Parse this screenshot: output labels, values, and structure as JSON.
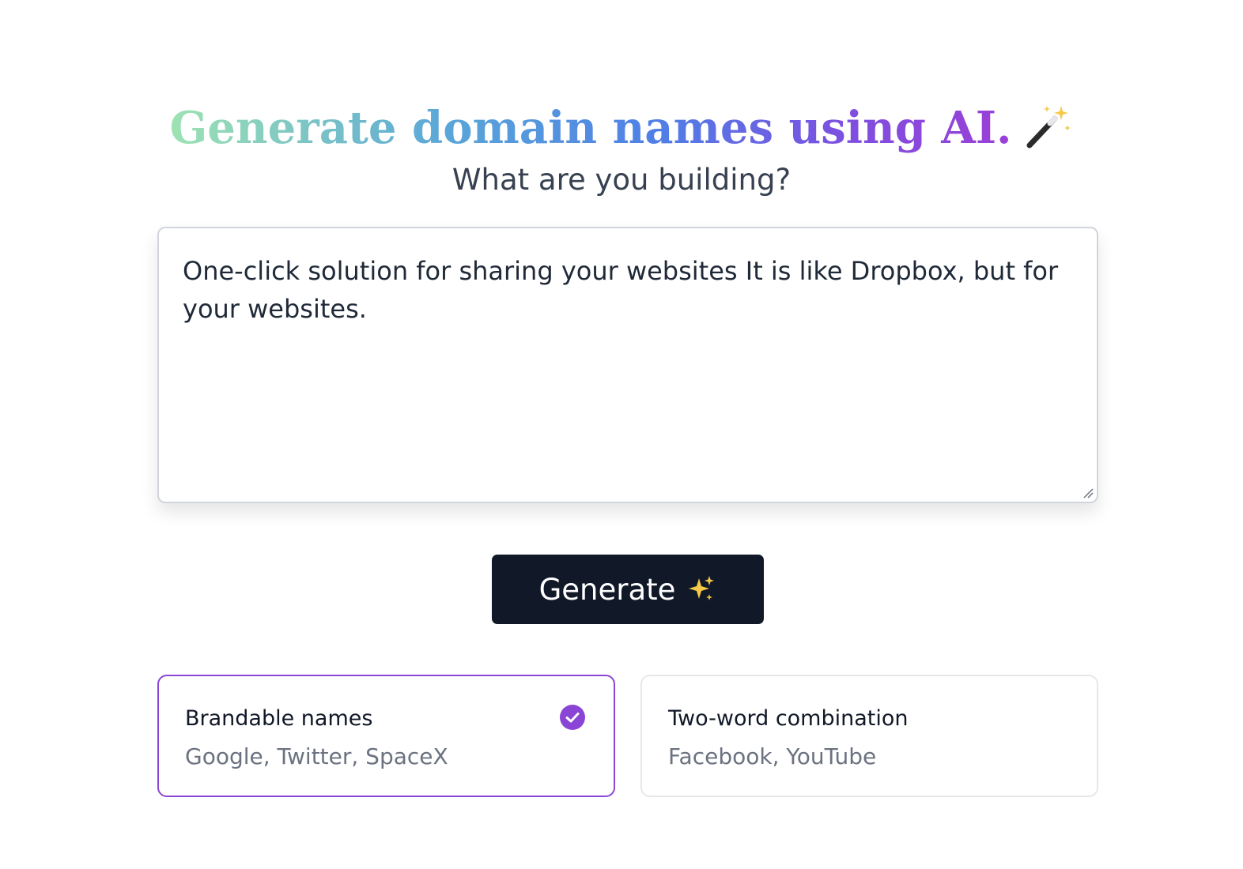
{
  "header": {
    "title": "Generate domain names using AI.",
    "title_icon": "magic-wand-icon",
    "gradient_colors": [
      "#9ee3b2",
      "#5aa6d8",
      "#4f7fe6",
      "#7d4fe0",
      "#9b3fd6"
    ]
  },
  "prompt": {
    "question": "What are you building?",
    "value": "One-click solution for sharing your websites It is like Dropbox, but for your websites."
  },
  "actions": {
    "generate_label": "Generate",
    "generate_icon": "sparkles-icon",
    "button_color": "#111827"
  },
  "options": [
    {
      "title": "Brandable names",
      "examples": "Google, Twitter, SpaceX",
      "selected": true,
      "accent": "#8b45d6"
    },
    {
      "title": "Two-word combination",
      "examples": "Facebook, YouTube",
      "selected": false
    }
  ]
}
